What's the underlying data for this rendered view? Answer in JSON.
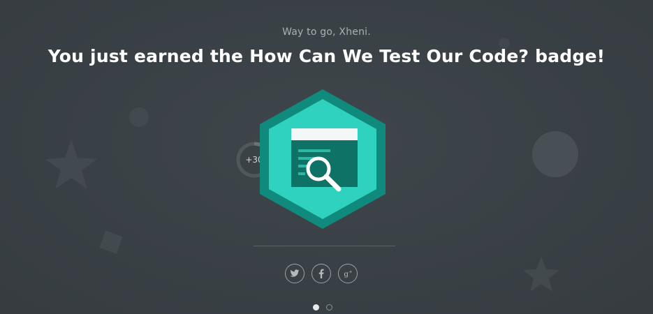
{
  "congrats": {
    "subtitle": "Way to go, Xheni.",
    "headline": "You just earned the How Can We Test Our Code? badge!"
  },
  "badge": {
    "icon": "code-window-magnifier-icon",
    "points": "+30",
    "colors": {
      "hex_outer": "#0f8a7d",
      "hex_inner": "#2fd2bf",
      "window_dark": "#0f7266",
      "window_header": "#f4f7f7",
      "ring": "#59b7ac"
    }
  },
  "share": {
    "buttons": [
      {
        "icon": "twitter-icon"
      },
      {
        "icon": "facebook-icon"
      },
      {
        "icon": "google-plus-icon"
      }
    ]
  },
  "pager": {
    "pages": 2,
    "active": 1
  }
}
